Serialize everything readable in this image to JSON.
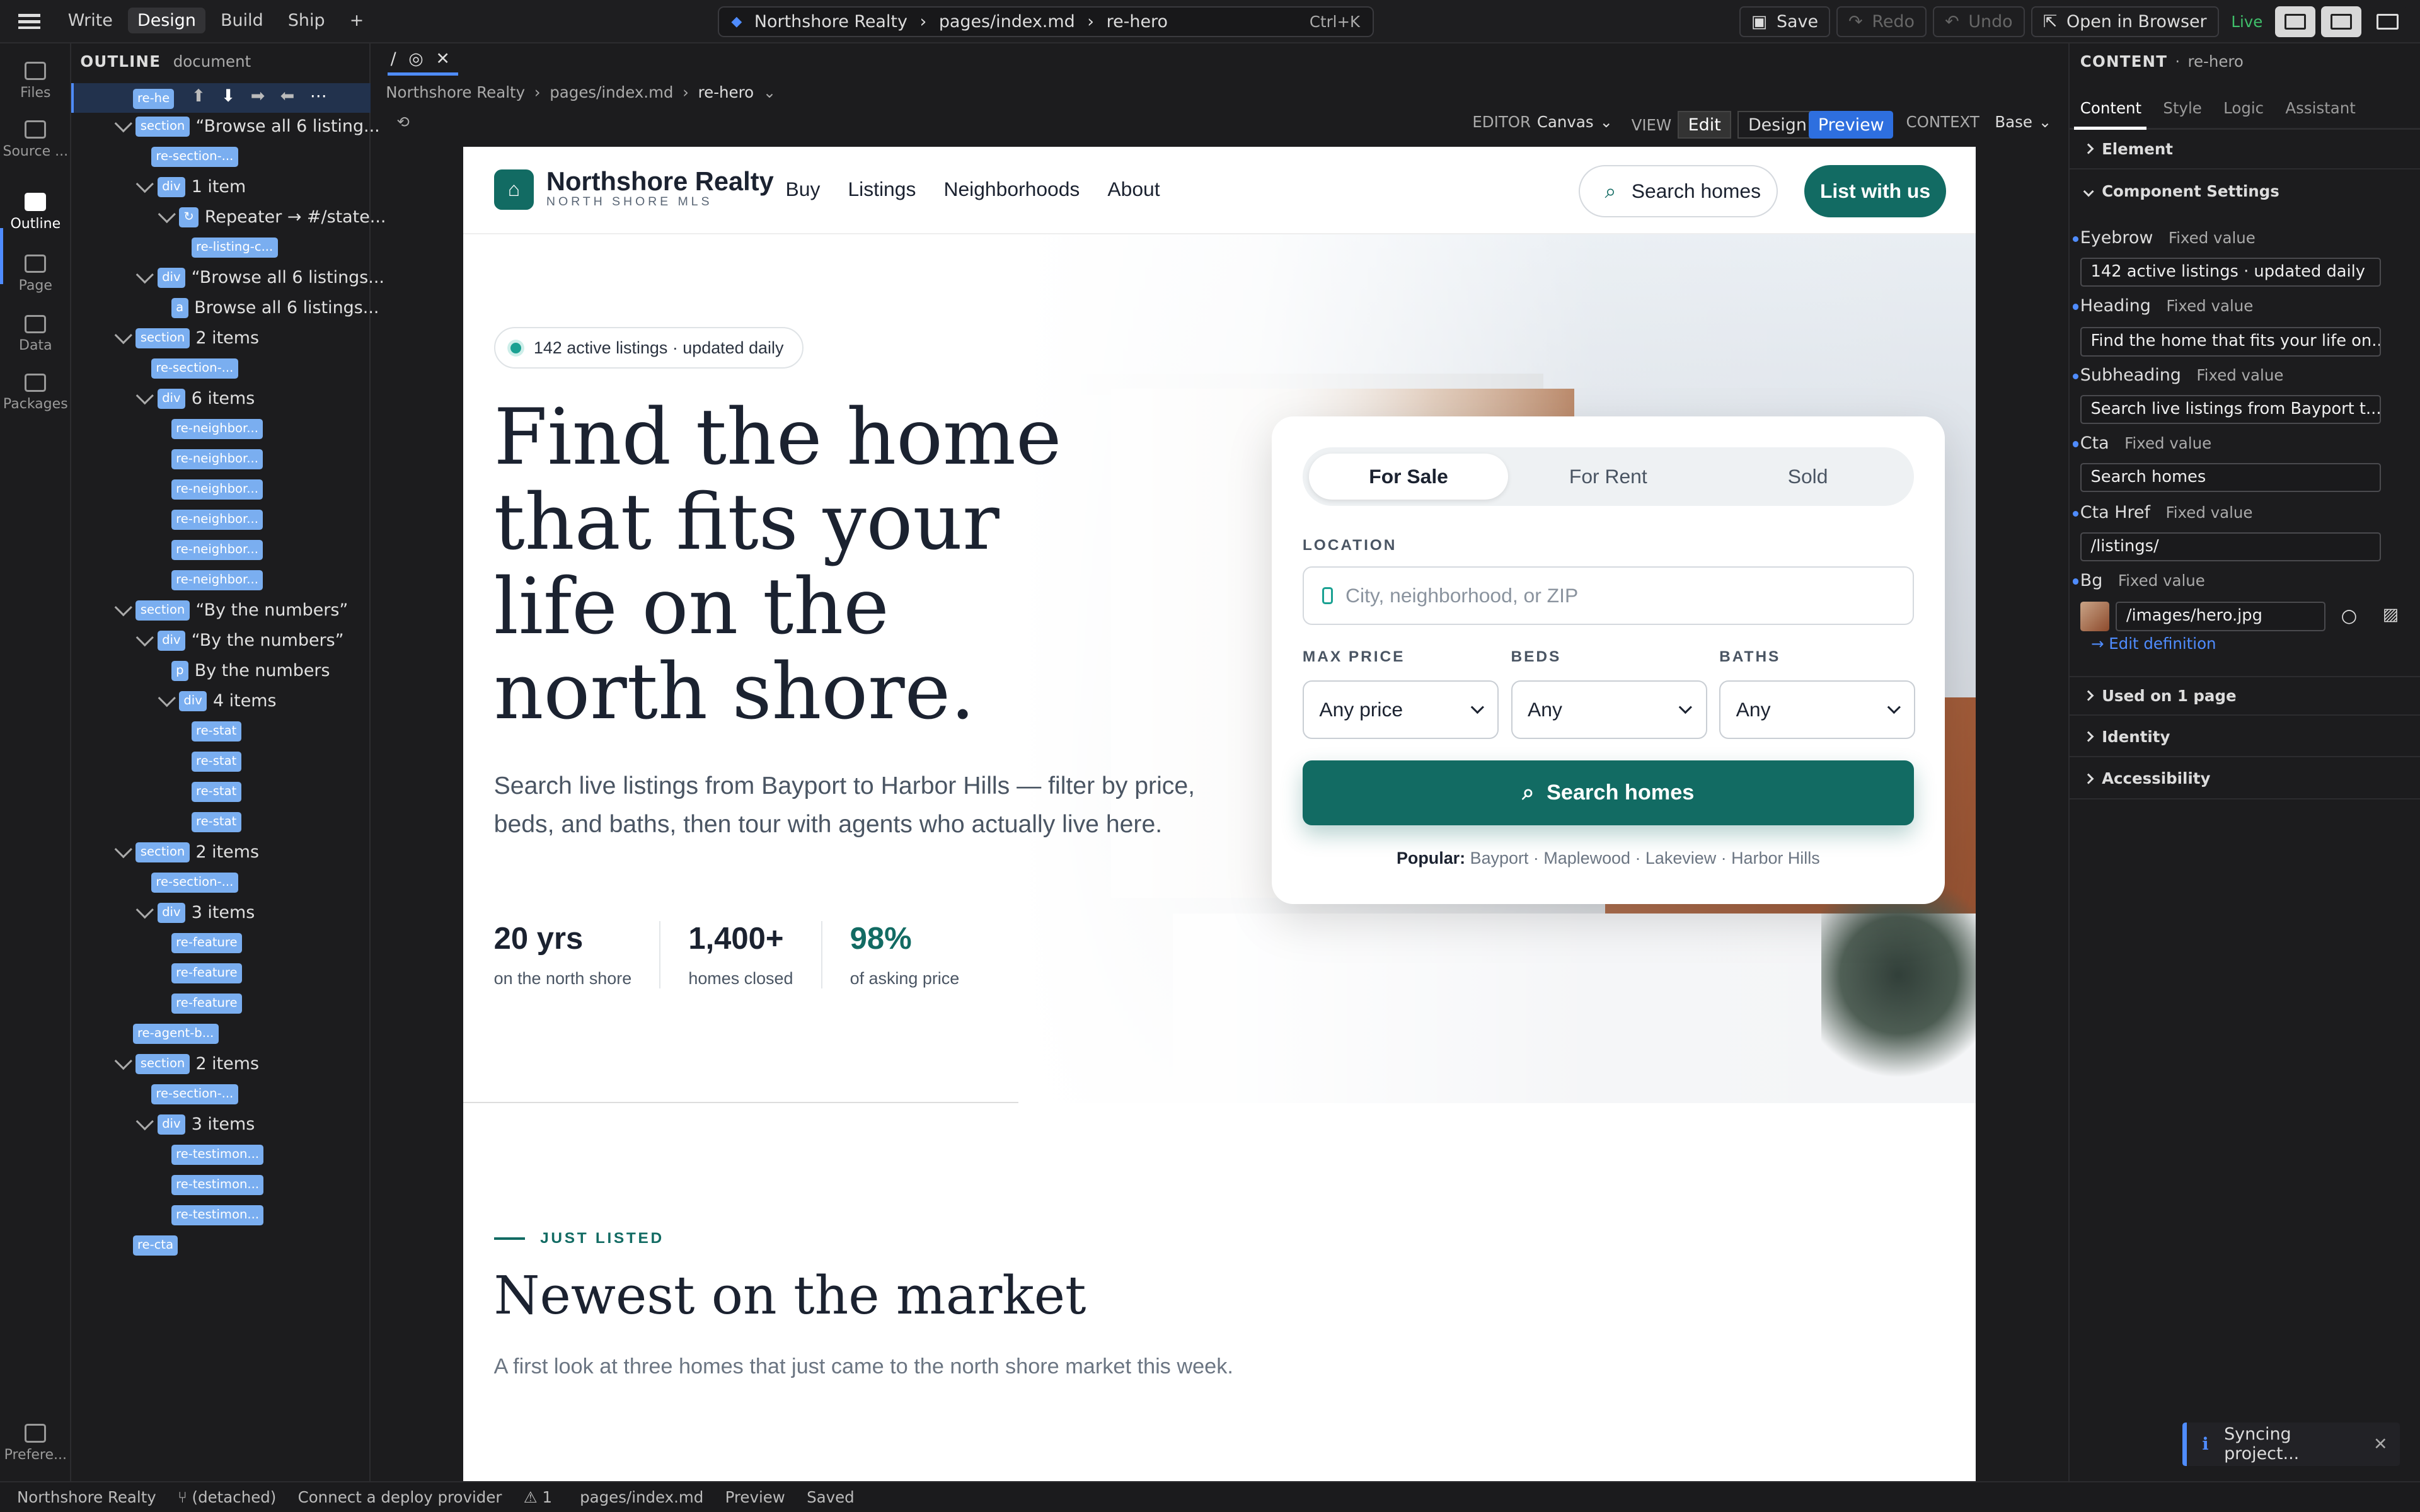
{
  "topbar": {
    "modes": [
      "Write",
      "Design",
      "Build",
      "Ship",
      "+"
    ],
    "command": {
      "project": "Northshore Realty",
      "file": "pages/index.md",
      "node": "re-hero",
      "shortcut": "Ctrl+K"
    },
    "actions": {
      "save": "Save",
      "redo": "Redo",
      "undo": "Undo",
      "open": "Open in Browser",
      "live": "Live"
    }
  },
  "rail": {
    "items": [
      "Files",
      "Source ...",
      "Outline",
      "Page",
      "Data",
      "Packages",
      "Prefere..."
    ]
  },
  "outline": {
    "title": "OUTLINE",
    "scope": "document",
    "rows": [
      {
        "tag": "re-he",
        "selected": true
      },
      {
        "tag": "section",
        "text": "“Browse all 6 listing..."
      },
      {
        "chip": "re-section-..."
      },
      {
        "tag": "div",
        "text": "1 item"
      },
      {
        "tag": "↻",
        "text": "Repeater → #/state..."
      },
      {
        "chip": "re-listing-c..."
      },
      {
        "tag": "div",
        "text": "“Browse all 6 listings..."
      },
      {
        "tag": "a",
        "text": "Browse all 6 listings..."
      },
      {
        "tag": "section",
        "text": "2 items"
      },
      {
        "chip": "re-section-..."
      },
      {
        "tag": "div",
        "text": "6 items"
      },
      {
        "chip": "re-neighbor..."
      },
      {
        "chip": "re-neighbor..."
      },
      {
        "chip": "re-neighbor..."
      },
      {
        "chip": "re-neighbor..."
      },
      {
        "chip": "re-neighbor..."
      },
      {
        "chip": "re-neighbor..."
      },
      {
        "tag": "section",
        "text": "“By the numbers”"
      },
      {
        "tag": "div",
        "text": "“By the numbers”"
      },
      {
        "tag": "p",
        "text": "By the numbers"
      },
      {
        "tag": "div",
        "text": "4 items"
      },
      {
        "chip": "re-stat"
      },
      {
        "chip": "re-stat"
      },
      {
        "chip": "re-stat"
      },
      {
        "chip": "re-stat"
      },
      {
        "tag": "section",
        "text": "2 items"
      },
      {
        "chip": "re-section-..."
      },
      {
        "tag": "div",
        "text": "3 items"
      },
      {
        "chip": "re-feature"
      },
      {
        "chip": "re-feature"
      },
      {
        "chip": "re-feature"
      },
      {
        "chip": "re-agent-b..."
      },
      {
        "tag": "section",
        "text": "2 items"
      },
      {
        "chip": "re-section-..."
      },
      {
        "tag": "div",
        "text": "3 items"
      },
      {
        "chip": "re-testimon..."
      },
      {
        "chip": "re-testimon..."
      },
      {
        "chip": "re-testimon..."
      },
      {
        "chip": "re-cta"
      }
    ]
  },
  "doc": {
    "tab": "/",
    "breadcrumb": [
      "Northshore Realty",
      "pages/index.md",
      "re-hero"
    ],
    "viewbar": {
      "editor_label": "EDITOR",
      "editor_value": "Canvas",
      "view_label": "VIEW",
      "edit": "Edit",
      "design": "Design",
      "preview": "Preview",
      "context_label": "CONTEXT",
      "context_value": "Base"
    }
  },
  "site": {
    "brand": "Northshore Realty",
    "brand_sub": "NORTH SHORE MLS",
    "nav": [
      "Buy",
      "Listings",
      "Neighborhoods",
      "About"
    ],
    "nav_search": "Search homes",
    "nav_cta": "List with us",
    "eyebrow": "142 active listings · updated daily",
    "heading": "Find the home that fits your life on the north shore.",
    "subheading": "Search live listings from Bayport to Harbor Hills — filter by price, beds, and baths, then tour with agents who actually live here.",
    "stats": [
      {
        "n": "20 yrs",
        "l": "on the north shore"
      },
      {
        "n": "1,400+",
        "l": "homes closed"
      },
      {
        "n": "98%",
        "l": "of asking price"
      }
    ],
    "card": {
      "tabs": [
        "For Sale",
        "For Rent",
        "Sold"
      ],
      "location_label": "LOCATION",
      "location_placeholder": "City, neighborhood, or ZIP",
      "max_price_label": "MAX PRICE",
      "max_price": "Any price",
      "beds_label": "BEDS",
      "beds": "Any",
      "baths_label": "BATHS",
      "baths": "Any",
      "button": "Search homes",
      "popular_label": "Popular:",
      "popular": "Bayport · Maplewood · Lakeview · Harbor Hills"
    },
    "just_listed": "JUST LISTED",
    "h2": "Newest on the market",
    "p2": "A first look at three homes that just came to the north shore market this week."
  },
  "right": {
    "title": "CONTENT",
    "node": "re-hero",
    "tabs": [
      "Content",
      "Style",
      "Logic",
      "Assistant"
    ],
    "sections": {
      "element": "Element",
      "component": "Component Settings",
      "used": "Used on 1 page",
      "identity": "Identity",
      "accessibility": "Accessibility"
    },
    "fields": [
      {
        "label": "Eyebrow",
        "mode": "Fixed value",
        "value": "142 active listings · updated daily"
      },
      {
        "label": "Heading",
        "mode": "Fixed value",
        "value": "Find the home that fits your life on..."
      },
      {
        "label": "Subheading",
        "mode": "Fixed value",
        "value": "Search live listings from Bayport t..."
      },
      {
        "label": "Cta",
        "mode": "Fixed value",
        "value": "Search homes"
      },
      {
        "label": "Cta Href",
        "mode": "Fixed value",
        "value": "/listings/"
      },
      {
        "label": "Bg",
        "mode": "Fixed value",
        "value": "/images/hero.jpg"
      }
    ],
    "edit_definition": "→ Edit definition"
  },
  "toast": "Syncing project...",
  "status": {
    "project": "Northshore Realty",
    "branch": "⑂ (detached)",
    "deploy": "Connect a deploy provider",
    "warnings": "⚠ 1",
    "file": "pages/index.md",
    "mode": "Preview",
    "saved": "Saved"
  },
  "colors": {
    "accent": "#4f8cff",
    "brand_teal": "#126b63"
  }
}
